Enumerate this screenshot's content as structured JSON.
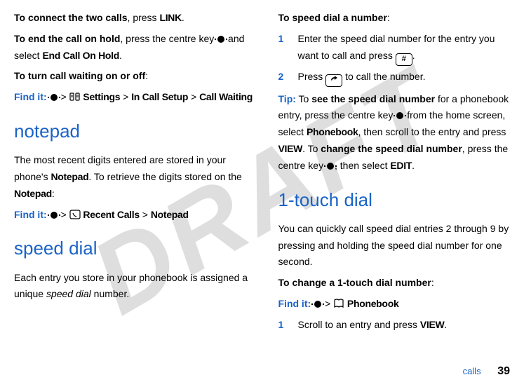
{
  "watermark": "DRAFT",
  "left": {
    "p1_pre": "To connect the two calls",
    "p1_mid": ", press ",
    "p1_link": "LINK",
    "p1_end": ".",
    "p2_pre": "To end the call on hold",
    "p2_mid": ", press the centre key ",
    "p2_post": " and select ",
    "p2_opt": "End Call On Hold",
    "p2_end": ".",
    "p3_pre": "To turn call waiting on or off",
    "p3_end": ":",
    "find1_label": "Find it:",
    "find1_path_settings": "Settings",
    "find1_path_incall": "In Call Setup",
    "find1_path_cw": "Call Waiting",
    "gt": ">",
    "h_notepad": "notepad",
    "p4a": "The most recent digits entered are stored in your phone's ",
    "p4_notepad": "Notepad",
    "p4b": ". To retrieve the digits stored on the ",
    "p4c": ":",
    "find2_label": "Find it:",
    "find2_recent": "Recent Calls",
    "find2_notepad": "Notepad",
    "h_speed": "speed dial",
    "p5a": "Each entry you store in your phonebook is assigned a unique ",
    "p5i": "speed dial",
    "p5b": " number."
  },
  "right": {
    "p1_pre": "To speed dial a number",
    "p1_end": ":",
    "s1_num": "1",
    "s1_a": "Enter the speed dial number for the entry you want to call and press ",
    "s1_key": "#",
    "s1_b": ".",
    "s2_num": "2",
    "s2_a": "Press ",
    "s2_key": "⏎",
    "s2_b": " to call the number.",
    "tip_label": "Tip:",
    "tip_a": " To ",
    "tip_bold1": "see the speed dial number",
    "tip_b": " for a phonebook entry, press the centre key ",
    "tip_c": " from the home screen, select ",
    "tip_pb": "Phonebook",
    "tip_d": ", then scroll to the entry and press ",
    "tip_view": "VIEW",
    "tip_e": ". To ",
    "tip_bold2": "change the speed dial number",
    "tip_f": ", press the centre key ",
    "tip_g": ", then select ",
    "tip_edit": "EDIT",
    "tip_h": ".",
    "h_onetouch": "1-touch dial",
    "p2": "You can quickly call speed dial entries 2 through 9 by pressing and holding the speed dial number for one second.",
    "p3_pre": "To change a 1-touch dial number",
    "p3_end": ":",
    "find3_label": "Find it:",
    "find3_pb": "Phonebook",
    "s3_num": "1",
    "s3_a": "Scroll to an entry and press ",
    "s3_view": "VIEW",
    "s3_b": "."
  },
  "footer": {
    "label": "calls",
    "page": "39"
  }
}
